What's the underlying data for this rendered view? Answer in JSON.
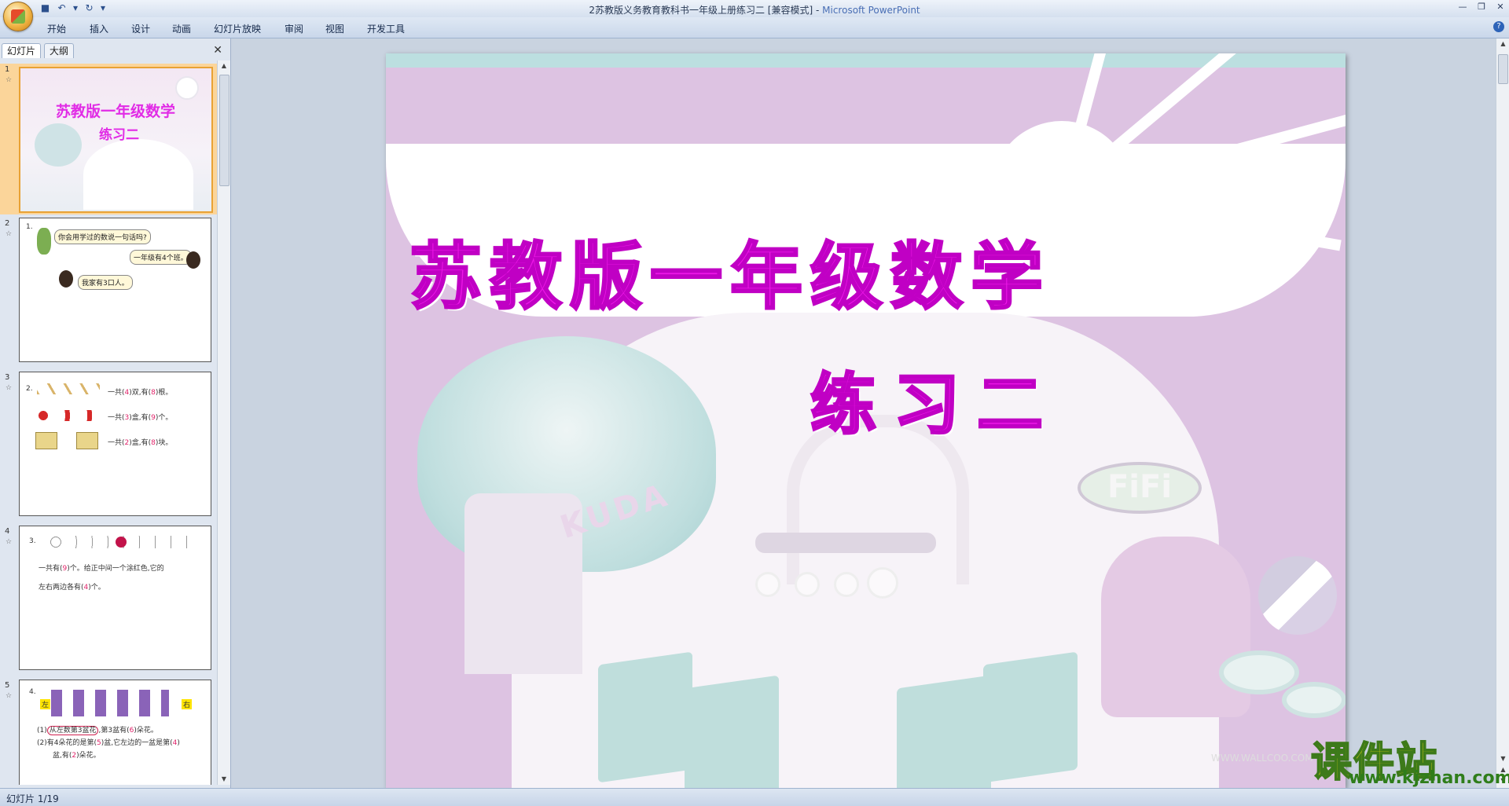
{
  "window": {
    "title": "2苏教版义务教育教科书一年级上册练习二 [兼容模式] - ",
    "app_name": "Microsoft PowerPoint"
  },
  "qat": {
    "save_icon": "save-icon",
    "undo_icon": "undo-icon",
    "redo_icon": "redo-icon",
    "more_icon": "customize-icon"
  },
  "ribbon_tabs": [
    "开始",
    "插入",
    "设计",
    "动画",
    "幻灯片放映",
    "审阅",
    "视图",
    "开发工具"
  ],
  "left_pane": {
    "tabs": [
      "幻灯片",
      "大纲"
    ],
    "slides": [
      {
        "num": "1",
        "title": "苏教版一年级数学",
        "subtitle": "练习二"
      },
      {
        "num": "2",
        "q": "1.",
        "b1": "你会用学过的数说一句话吗?",
        "b2": "一年级有4个班。",
        "b3": "我家有3口人。"
      },
      {
        "num": "3",
        "q": "2.",
        "l1a": "一共(",
        "l1v": "4",
        "l1b": ")双,有(",
        "l1w": "8",
        "l1c": ")根。",
        "l2a": "一共(",
        "l2v": "3",
        "l2b": ")盒,有(",
        "l2w": "9",
        "l2c": ")个。",
        "l3a": "一共(",
        "l3v": "2",
        "l3b": ")盒,有(",
        "l3w": "8",
        "l3c": ")块。"
      },
      {
        "num": "4",
        "q": "3.",
        "l1a": "一共有(",
        "l1v": "9",
        "l1b": ")个",
        "l1c": "。给正中间一个",
        "l1d": "涂红色,它的",
        "l2a": "左右两边各有(",
        "l2v": "4",
        "l2b": ")个",
        "l2c": "。"
      },
      {
        "num": "5",
        "q": "4.",
        "left": "左",
        "right": "右",
        "l1a": "(1)",
        "l1b": "从左数第3盆花",
        "l1c": ",第3盆有(",
        "l1v": "6",
        "l1d": ")朵花。",
        "l2a": "(2)有4朵花的是第(",
        "l2v": "5",
        "l2b": ")盆,它左边的一盆是第(",
        "l2w": "4",
        "l2c": ")",
        "l3a": "盆,有(",
        "l3v": "2",
        "l3b": ")朵花。"
      }
    ]
  },
  "slide": {
    "title": "苏教版一年级数学",
    "subtitle": "练习二",
    "sign_kuda": "KUDA",
    "sign_fifi": "FiFi",
    "watermark": "WWW.WALLCOO.COM"
  },
  "brand": {
    "name": "课件站",
    "url": "www.kjzhan.com"
  },
  "status": {
    "slide_counter": "幻灯片 1/19"
  },
  "colors": {
    "title_magenta": "#ee17e8",
    "selection_orange": "#e8a235",
    "ribbon_blue": "#c9d7ea"
  }
}
